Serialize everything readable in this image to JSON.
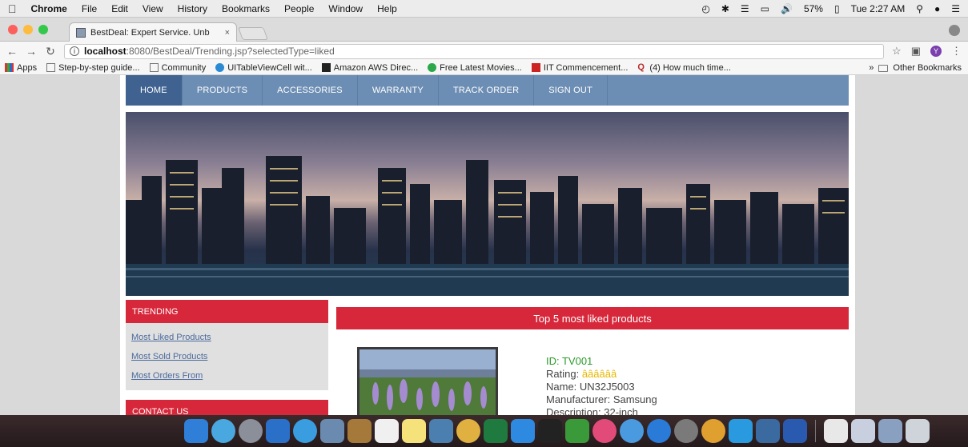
{
  "menubar": {
    "app": "Chrome",
    "items": [
      "File",
      "Edit",
      "View",
      "History",
      "Bookmarks",
      "People",
      "Window",
      "Help"
    ],
    "battery": "57%",
    "clock": "Tue 2:27 AM"
  },
  "tab": {
    "title": "BestDeal: Expert Service. Unb",
    "close": "×"
  },
  "toolbar": {
    "url_host": "localhost",
    "url_path": ":8080/BestDeal/Trending.jsp?selectedType=liked",
    "info": "i",
    "profile_letter": "Y"
  },
  "bookmarks": {
    "items": [
      "Apps",
      "Step-by-step guide...",
      "Community",
      "UITableViewCell wit...",
      "Amazon AWS Direc...",
      "Free Latest Movies...",
      "IIT Commencement...",
      "(4) How much time..."
    ],
    "overflow": "»",
    "other": "Other Bookmarks"
  },
  "navbar": {
    "items": [
      "HOME",
      "PRODUCTS",
      "ACCESSORIES",
      "WARRANTY",
      "TRACK ORDER",
      "SIGN OUT"
    ]
  },
  "sidebar": {
    "trending_title": "TRENDING",
    "links": [
      "Most Liked Products",
      "Most Sold Products",
      "Most Orders From"
    ],
    "contact_title": "CONTACT US"
  },
  "main": {
    "heading": "Top 5 most liked products",
    "product": {
      "id": "ID: TV001",
      "rating_label": "Rating:",
      "rating_stars": "ââââââ",
      "name": "Name: UN32J5003",
      "manufacturer": "Manufacturer: Samsung",
      "description": "Description: 32-inch"
    }
  },
  "colors": {
    "nav_bg": "#6d8eb4",
    "nav_active": "#3f6291",
    "accent_red": "#d7273a",
    "link": "#4a6a9c",
    "id_green": "#2a9a2a"
  }
}
